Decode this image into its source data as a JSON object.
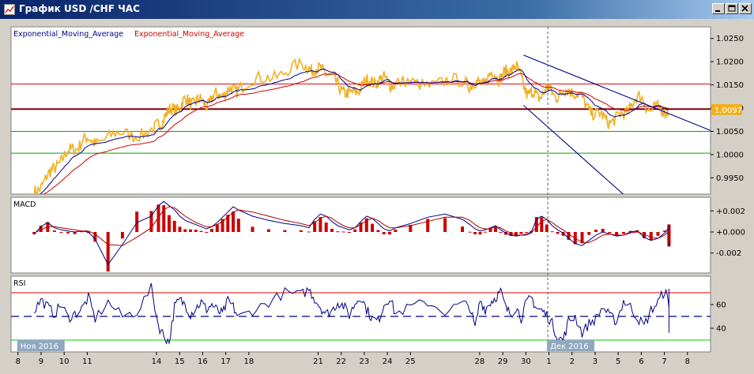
{
  "window": {
    "title": "График USD /CHF  ЧАС",
    "icons": [
      "chart-window-icon",
      "minimize-icon",
      "maximize-icon",
      "close-icon"
    ]
  },
  "colors": {
    "price": "#f0b020",
    "ema_fast": "#00008b",
    "ema_slow": "#cc0000",
    "resistance": "#dd0000",
    "pivot": "#800000",
    "support": "#00aa00",
    "channel": "#000080",
    "macd_hist": "#cc0000",
    "rsi_line": "#000080",
    "rsi_overbought": "#c000c0",
    "price_tag_bg": "#f0b020",
    "panel_bg": "#ffffff"
  },
  "chart_data": [
    {
      "type": "line",
      "name": "price-panel",
      "legend": [
        "Exponential_Moving_Average",
        "Exponential_Moving_Average"
      ],
      "ylim": [
        0.9915,
        1.0275
      ],
      "y_ticks": [
        0.995,
        1.0,
        1.005,
        1.01,
        1.015,
        1.02,
        1.025
      ],
      "y_tick_labels": [
        "0.9950",
        "1.0000",
        "1.0050",
        "1.0100",
        "1.0150",
        "1.0200",
        "1.0250"
      ],
      "current_price": "1.0097",
      "current_value": 1.0097,
      "horizontal_levels": [
        {
          "kind": "resistance",
          "value": 1.0152
        },
        {
          "kind": "pivot",
          "value": 1.0098
        },
        {
          "kind": "support",
          "value": 1.005
        },
        {
          "kind": "support",
          "value": 1.0003
        }
      ],
      "channel": [
        {
          "x": [
            29.9,
            32.0
          ],
          "y": [
            1.0214,
            1.0172
          ]
        },
        {
          "x": [
            29.9,
            32.0
          ],
          "y": [
            1.0106,
            1.0013
          ]
        }
      ],
      "x": [
        8.7,
        8.95,
        9.2,
        9.45,
        9.7,
        9.95,
        10.2,
        10.45,
        10.7,
        10.95,
        11.2,
        11.45,
        11.7,
        11.95,
        12.2,
        12.45,
        12.7,
        12.95,
        13.2,
        13.45,
        13.7,
        13.95,
        14.2,
        14.45,
        14.7,
        14.95,
        15.2,
        15.45,
        15.7,
        15.95,
        16.2,
        16.45,
        16.7,
        16.95,
        17.2,
        17.45,
        17.7,
        17.95,
        18.2,
        18.45,
        18.7,
        18.95,
        19.2,
        19.45,
        19.7,
        19.95,
        20.2,
        20.45,
        20.7,
        20.95,
        21.2,
        21.45,
        21.7,
        21.95,
        22.2,
        22.45,
        22.7,
        22.95,
        23.2,
        23.45,
        23.7,
        23.95,
        24.2,
        24.45,
        24.7,
        24.95,
        25.2,
        25.45,
        25.7,
        25.95,
        26.2,
        26.45,
        26.7,
        26.95,
        27.2,
        27.45,
        27.7,
        27.95,
        28.2,
        28.45,
        28.7,
        28.95,
        29.2,
        29.45,
        29.7,
        29.95,
        30.2,
        30.45,
        30.7,
        30.95,
        31.2,
        31.45,
        31.7,
        31.95,
        32.2,
        32.45
      ],
      "series": [
        {
          "role": "price",
          "values": []
        },
        {
          "role": "ema_fast",
          "values": []
        },
        {
          "role": "ema_slow",
          "values": []
        }
      ]
    },
    {
      "type": "bar",
      "name": "macd-panel",
      "label": "MACD",
      "ylim": [
        -0.0039,
        0.0033
      ],
      "y_ticks": [
        0.002,
        0.0,
        -0.002
      ],
      "y_tick_labels": [
        "+0.002",
        "+0.000",
        "-0.002"
      ],
      "x": [
        9.0,
        9.25,
        9.5,
        9.75,
        10.0,
        10.25,
        10.5,
        10.75,
        11.0,
        11.25,
        11.5,
        11.75,
        12.0,
        12.25,
        12.5,
        12.75,
        13.0,
        13.25,
        13.5,
        13.75,
        14.0,
        14.25,
        14.5,
        14.75,
        15.0,
        15.25,
        15.5,
        15.75,
        16.0,
        16.25,
        16.5,
        16.75,
        17.0,
        17.25,
        17.5,
        17.75,
        18.0,
        18.25,
        18.5,
        18.75,
        19.0,
        19.25,
        19.5,
        19.75,
        20.0,
        20.25,
        20.5,
        20.75,
        21.0,
        21.25,
        21.5,
        21.75,
        22.0,
        22.25,
        22.5,
        22.75,
        23.0,
        23.25,
        23.5,
        23.75,
        24.0,
        24.25,
        24.5,
        24.75,
        25.0,
        25.25,
        25.5,
        25.75,
        26.0,
        26.25,
        26.5,
        26.75,
        27.0,
        27.25,
        27.5,
        27.75,
        28.0,
        28.25,
        28.5,
        28.75,
        29.0,
        29.25,
        29.5,
        29.75,
        30.0,
        30.25,
        30.5,
        30.75,
        31.0,
        31.25,
        31.5,
        31.75,
        32.0,
        32.25,
        32.5,
        32.75,
        33.0
      ],
      "macd": [
        -0.0002,
        0.0005,
        0.0009,
        0.0004,
        0.0002,
        0.0001,
        0.0,
        0.0001,
        0.0,
        -0.0007,
        -0.0031,
        -0.0012,
        0.0009,
        0.0015,
        0.0025,
        0.0029,
        0.0025,
        0.0021,
        0.0015,
        0.0011,
        0.0009,
        0.0007,
        0.0005,
        0.0003,
        0.0005,
        0.0009,
        0.0014,
        0.0019,
        0.0024,
        0.0021,
        0.0015,
        0.0011,
        0.0008,
        0.0006,
        0.0004,
        0.0012,
        0.0017,
        0.0015,
        0.001,
        0.0006,
        0.0004,
        0.0002,
        0.0004,
        0.001,
        0.0015,
        0.0013,
        0.0008,
        0.0003,
        0.0001,
        0.0004,
        0.0008,
        0.0014,
        0.0017,
        0.0012,
        0.0007,
        0.0003,
        0.0001,
        0.0002,
        0.0004,
        0.0006,
        0.0002,
        -0.0001,
        -0.0003,
        -0.0004,
        -0.0003,
        -0.0002,
        0.0,
        0.0012,
        0.0015,
        0.0012,
        0.0006,
        0.0002,
        -0.0001,
        -0.0006,
        -0.0011,
        -0.0013,
        -0.0008,
        -0.0003,
        0.0,
        -0.0002,
        -0.0004,
        -0.0003,
        0.0,
        0.0001,
        -0.0005,
        -0.0008,
        -0.0006,
        -0.0001,
        0.0004,
        0.0007,
        -0.0002,
        -0.0011,
        -0.0014,
        -0.001,
        -0.0004,
        0.0002,
        0.0003
      ],
      "signal": [
        -0.0001,
        0.0002,
        0.0005,
        0.0005,
        0.0004,
        0.0003,
        0.0002,
        0.0001,
        0.0001,
        -0.0002,
        -0.0012,
        -0.0013,
        -0.0005,
        0.0004,
        0.0014,
        0.0021,
        0.0024,
        0.0023,
        0.0019,
        0.0015,
        0.0012,
        0.0009,
        0.0007,
        0.0005,
        0.0005,
        0.0007,
        0.001,
        0.0014,
        0.0019,
        0.0021,
        0.0019,
        0.0015,
        0.0011,
        0.0008,
        0.0006,
        0.0009,
        0.0013,
        0.0015,
        0.0013,
        0.0009,
        0.0006,
        0.0004,
        0.0004,
        0.0007,
        0.0011,
        0.0013,
        0.0011,
        0.0007,
        0.0004,
        0.0004,
        0.0006,
        0.001,
        0.0014,
        0.0014,
        0.0011,
        0.0007,
        0.0004,
        0.0003,
        0.0003,
        0.0005,
        0.0004,
        0.0001,
        -0.0001,
        -0.0003,
        -0.0003,
        -0.0003,
        -0.0001,
        0.0005,
        0.001,
        0.0012,
        0.0009,
        0.0005,
        0.0002,
        -0.0002,
        -0.0006,
        -0.001,
        -0.001,
        -0.0007,
        -0.0003,
        -0.0002,
        -0.0003,
        -0.0003,
        -0.0001,
        0.0,
        -0.0002,
        -0.0005,
        -0.0006,
        -0.0003,
        0.0001,
        0.0004,
        0.0002,
        -0.0004,
        -0.0009,
        -0.001,
        -0.0007,
        -0.0002,
        0.0001
      ]
    },
    {
      "type": "line",
      "name": "rsi-panel",
      "label": "RSI",
      "ylim": [
        20,
        84
      ],
      "y_ticks": [
        60,
        40
      ],
      "y_tick_labels": [
        "60",
        "40"
      ],
      "levels": [
        {
          "kind": "overbought",
          "value": 70
        },
        {
          "kind": "mid",
          "value": 50
        },
        {
          "kind": "oversold",
          "value": 30
        }
      ],
      "x": [
        8.7,
        8.95,
        9.2,
        9.45,
        9.7,
        9.95,
        10.2,
        10.45,
        10.7,
        10.95,
        11.2,
        11.45,
        11.7,
        11.95,
        12.2,
        12.45,
        12.7,
        12.95,
        13.2,
        13.45,
        13.7,
        13.95,
        14.2,
        14.45,
        14.7,
        14.95,
        15.2,
        15.45,
        15.7,
        15.95,
        16.2,
        16.45,
        16.7,
        16.95,
        17.2,
        17.45,
        17.7,
        17.95,
        18.2,
        18.45,
        18.7,
        18.95,
        19.2,
        19.45,
        19.7,
        19.95,
        20.2,
        20.45,
        20.7,
        20.95,
        21.2,
        21.45,
        21.7,
        21.95,
        22.2,
        22.45,
        22.7,
        22.95,
        23.2,
        23.45,
        23.7,
        23.95,
        24.2,
        24.45,
        24.7,
        24.95,
        25.2,
        25.45,
        25.7,
        25.95,
        26.2,
        26.45,
        26.7,
        26.95,
        27.2,
        27.45,
        27.7,
        27.95,
        28.2,
        28.45,
        28.7,
        28.95,
        29.2,
        29.45,
        29.7,
        29.95,
        30.2,
        30.45,
        30.7,
        30.95,
        31.2,
        31.45,
        31.7,
        31.95,
        32.2,
        32.45,
        32.7,
        32.95,
        33.1
      ],
      "values": [
        55,
        64,
        58,
        52,
        60,
        49,
        52,
        56,
        66,
        48,
        62,
        50,
        54,
        74,
        42,
        34,
        28,
        58,
        64,
        60,
        52,
        57,
        62,
        56,
        60,
        55,
        52,
        63,
        58,
        49,
        55,
        62,
        70,
        68,
        73,
        65,
        58,
        52,
        55,
        62,
        59,
        51,
        61,
        67,
        56,
        48,
        46,
        60,
        66,
        52,
        58,
        62,
        54,
        61,
        58,
        40,
        64,
        56,
        62,
        66,
        71,
        57,
        52,
        58,
        49,
        61,
        66,
        57,
        55,
        51,
        44,
        32,
        30,
        46,
        50,
        36,
        44,
        48,
        58,
        50,
        46,
        63,
        58,
        49,
        42,
        55,
        62,
        72,
        61,
        46,
        38,
        44,
        41,
        35,
        46,
        52,
        70,
        55,
        44,
        38,
        43
      ]
    }
  ],
  "x_axis": {
    "month_labels": [
      {
        "day": 8,
        "text": "Ноя 2016"
      },
      {
        "day": 30.95,
        "text": "Дек 2016"
      }
    ],
    "ticks": [
      {
        "pos": 8,
        "label": "8"
      },
      {
        "pos": 9,
        "label": "9"
      },
      {
        "pos": 10,
        "label": "10"
      },
      {
        "pos": 11,
        "label": "11"
      },
      {
        "pos": 14,
        "label": "14"
      },
      {
        "pos": 15,
        "label": "15"
      },
      {
        "pos": 16,
        "label": "16"
      },
      {
        "pos": 17,
        "label": "17"
      },
      {
        "pos": 18,
        "label": "18"
      },
      {
        "pos": 21,
        "label": "21"
      },
      {
        "pos": 22,
        "label": "22"
      },
      {
        "pos": 23,
        "label": "23"
      },
      {
        "pos": 24,
        "label": "24"
      },
      {
        "pos": 25,
        "label": "25"
      },
      {
        "pos": 28,
        "label": "28"
      },
      {
        "pos": 29,
        "label": "29"
      },
      {
        "pos": 30,
        "label": "30"
      },
      {
        "pos": 31,
        "label": "1"
      },
      {
        "pos": 32,
        "label": "2"
      },
      {
        "pos": 33,
        "label": "3"
      },
      {
        "pos": 34,
        "label": "5"
      },
      {
        "pos": 35,
        "label": "6"
      },
      {
        "pos": 36,
        "label": "7"
      },
      {
        "pos": 37,
        "label": "8"
      }
    ],
    "crosshair_x": 30.95
  }
}
